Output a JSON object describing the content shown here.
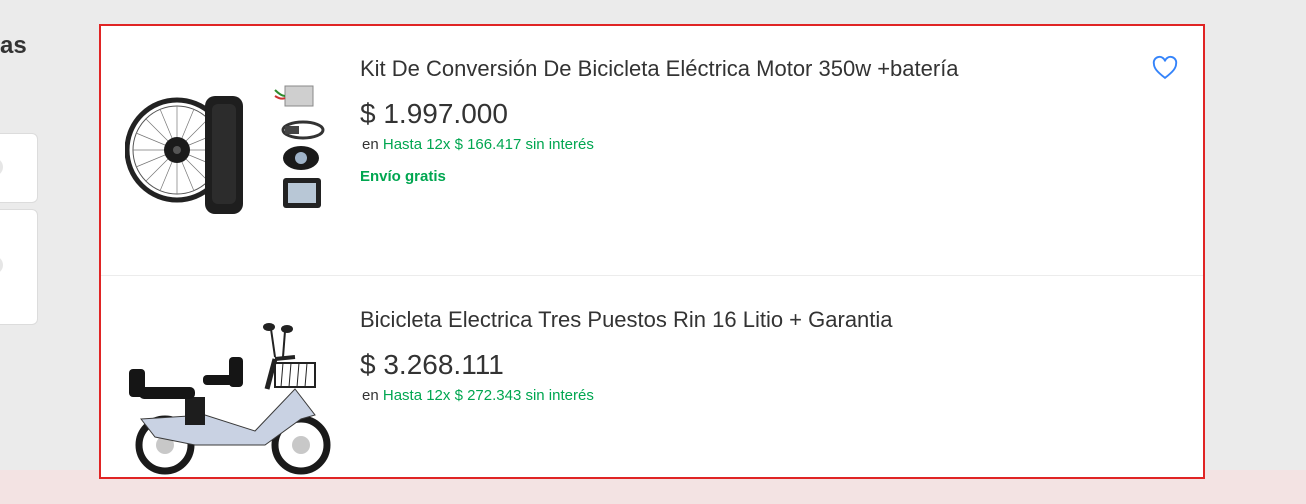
{
  "sidebar": {
    "heading": "as"
  },
  "results": [
    {
      "title": "Kit De Conversión De Bicicleta Eléctrica Motor 350w +batería",
      "price": "$ 1.997.000",
      "installments_prefix": "en",
      "installments_text": "Hasta 12x $ 166.417 sin interés",
      "shipping": "Envío gratis",
      "image_icon": "ebike-conversion-kit-image",
      "favorite_icon": "heart-outline-icon"
    },
    {
      "title": "Bicicleta Electrica Tres Puestos Rin 16 Litio + Garantia",
      "price": "$ 3.268.111",
      "installments_prefix": "en",
      "installments_text": "Hasta 12x $ 272.343 sin interés",
      "image_icon": "electric-scooter-image"
    }
  ],
  "colors": {
    "green": "#00a650",
    "highlight_border": "#e02424",
    "favorite": "#3483fa"
  }
}
